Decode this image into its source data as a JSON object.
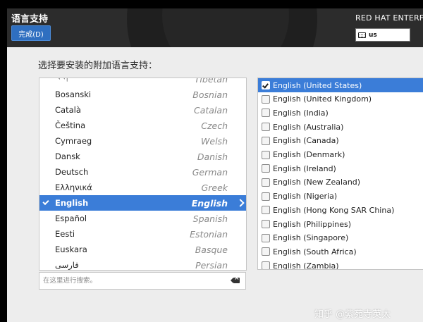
{
  "header": {
    "title": "语言支持",
    "done_label": "完成(D)",
    "product_name": "RED HAT ENTERF",
    "keyboard_layout": "us"
  },
  "prompt": "选择要安装的附加语言支持：",
  "languages": [
    {
      "native": "ཇོང་ཁ",
      "english": "Tibetan",
      "selected": false
    },
    {
      "native": "Bosanski",
      "english": "Bosnian",
      "selected": false
    },
    {
      "native": "Català",
      "english": "Catalan",
      "selected": false
    },
    {
      "native": "Čeština",
      "english": "Czech",
      "selected": false
    },
    {
      "native": "Cymraeg",
      "english": "Welsh",
      "selected": false
    },
    {
      "native": "Dansk",
      "english": "Danish",
      "selected": false
    },
    {
      "native": "Deutsch",
      "english": "German",
      "selected": false
    },
    {
      "native": "Ελληνικά",
      "english": "Greek",
      "selected": false
    },
    {
      "native": "English",
      "english": "English",
      "selected": true
    },
    {
      "native": "Español",
      "english": "Spanish",
      "selected": false
    },
    {
      "native": "Eesti",
      "english": "Estonian",
      "selected": false
    },
    {
      "native": "Euskara",
      "english": "Basque",
      "selected": false
    },
    {
      "native": "فارسی",
      "english": "Persian",
      "selected": false
    }
  ],
  "search": {
    "placeholder": "在这里进行搜索。",
    "value": ""
  },
  "locales": [
    {
      "label": "English (United States)",
      "checked": true
    },
    {
      "label": "English (United Kingdom)",
      "checked": false
    },
    {
      "label": "English (India)",
      "checked": false
    },
    {
      "label": "English (Australia)",
      "checked": false
    },
    {
      "label": "English (Canada)",
      "checked": false
    },
    {
      "label": "English (Denmark)",
      "checked": false
    },
    {
      "label": "English (Ireland)",
      "checked": false
    },
    {
      "label": "English (New Zealand)",
      "checked": false
    },
    {
      "label": "English (Nigeria)",
      "checked": false
    },
    {
      "label": "English (Hong Kong SAR China)",
      "checked": false
    },
    {
      "label": "English (Philippines)",
      "checked": false
    },
    {
      "label": "English (Singapore)",
      "checked": false
    },
    {
      "label": "English (South Africa)",
      "checked": false
    },
    {
      "label": "English (Zambia)",
      "checked": false
    }
  ],
  "watermark": "知乎 @紫苑寺英太",
  "colors": {
    "accent": "#3b7dd8",
    "header_bg": "#2c2c2c",
    "done_button": "#2f6fc0"
  }
}
